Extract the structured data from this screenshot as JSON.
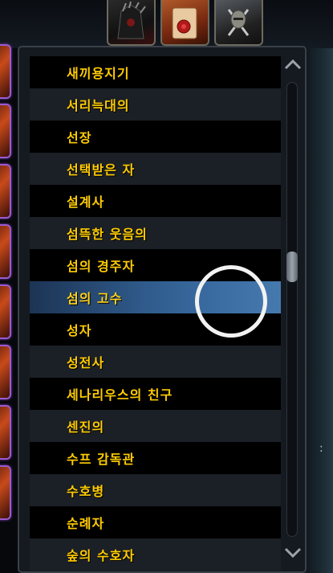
{
  "tabs": [
    {
      "name": "armored-helm-icon"
    },
    {
      "name": "scroll-seal-icon"
    },
    {
      "name": "knight-crossed-swords-icon"
    }
  ],
  "list": {
    "selected_index": 7,
    "items": [
      "새끼용지기",
      "서리늑대의",
      "선장",
      "선택받은 자",
      "설계사",
      "섬뜩한 웃음의",
      "섬의 경주자",
      "섬의 고수",
      "성자",
      "성전사",
      "세나리우스의 친구",
      "센진의",
      "수프 감독관",
      "수호병",
      "순례자",
      "숲의 수호자"
    ]
  },
  "scrollbar": {
    "position_fraction": 0.4
  },
  "colors": {
    "text": "#ffcc00",
    "selected_row": "#3b6da3",
    "row_alt": "#1b1f26"
  },
  "stray_text": ":"
}
